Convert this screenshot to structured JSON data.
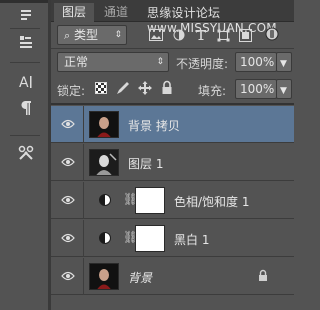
{
  "tabs": [
    {
      "label": "图层"
    },
    {
      "label": "通道"
    }
  ],
  "watermark": "思缘设计论坛 www.MISSYUAN.COM",
  "filter": {
    "kind_label": "类型",
    "icons": [
      "image-filter-icon",
      "adjustment-filter-icon",
      "type-filter-icon",
      "shape-filter-icon",
      "smart-object-filter-icon",
      "filter-toggle-icon"
    ]
  },
  "blend": {
    "mode": "正常",
    "opacity_label": "不透明度:",
    "opacity_value": "100%"
  },
  "lock": {
    "label": "锁定:",
    "fill_label": "填充:",
    "fill_value": "100%"
  },
  "layers": [
    {
      "name": "背景 拷贝",
      "selected": true,
      "type": "image"
    },
    {
      "name": "图层 1",
      "selected": false,
      "type": "image"
    },
    {
      "name": "色相/饱和度 1",
      "selected": false,
      "type": "adjustment"
    },
    {
      "name": "黑白 1",
      "selected": false,
      "type": "adjustment"
    },
    {
      "name": "背景",
      "selected": false,
      "type": "background",
      "locked": true
    }
  ],
  "colors": {
    "panel_bg": "#535353",
    "selected_row": "#5c7796",
    "tab_bar": "#3c3c3c"
  }
}
